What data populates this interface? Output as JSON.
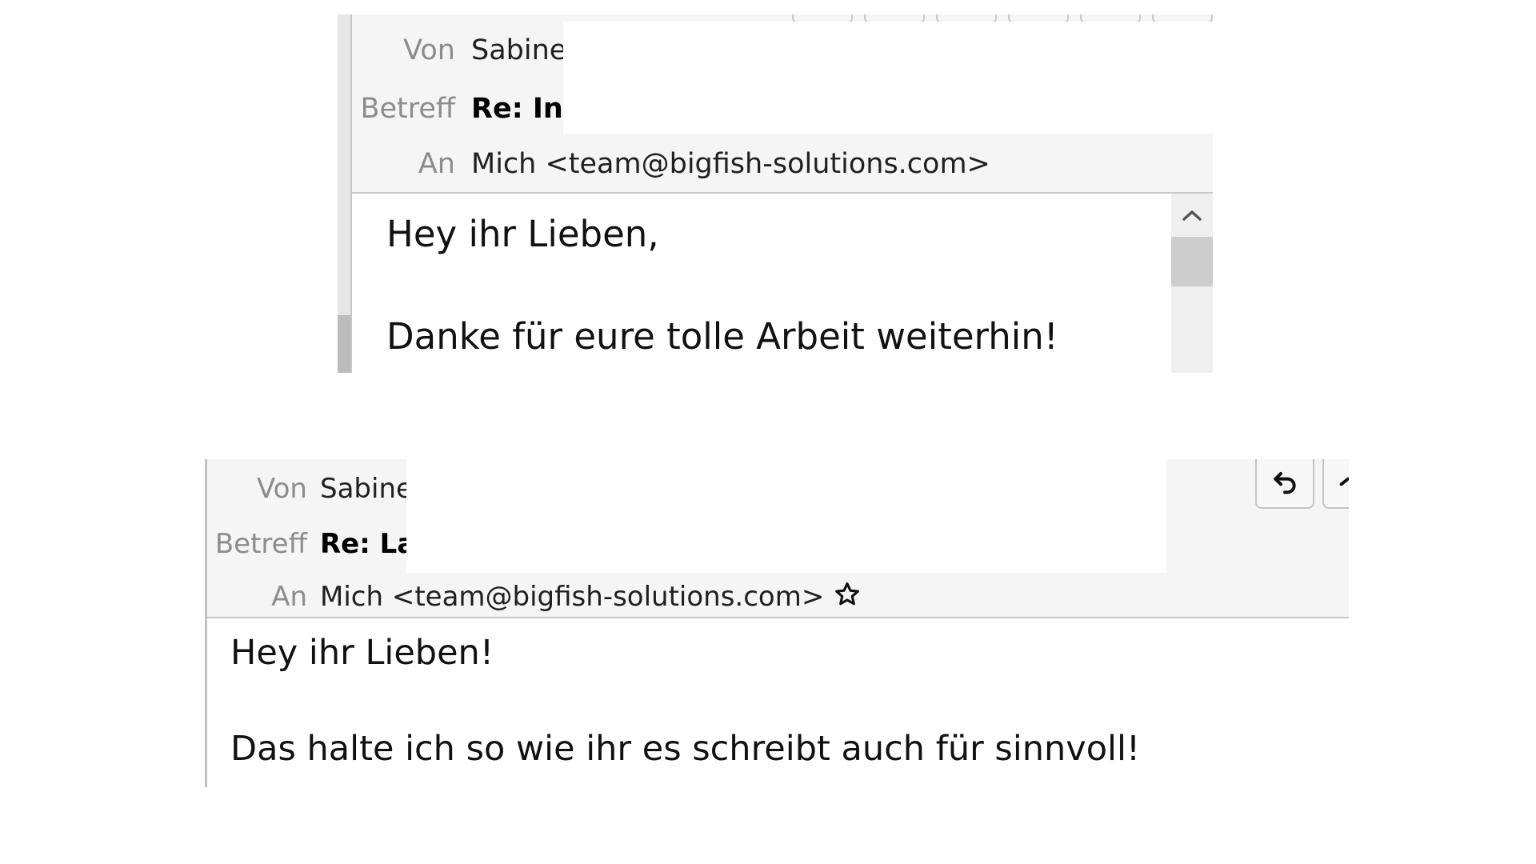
{
  "snippet_top": {
    "from_label": "Von",
    "from_value": "Sabine",
    "subject_label": "Betreff",
    "subject_value": "Re: Inf",
    "to_label": "An",
    "to_value": "Mich <team@bigfish-solutions.com>",
    "body": [
      "Hey ihr Lieben,",
      "Danke für eure tolle Arbeit weiterhin!"
    ]
  },
  "snippet_bottom": {
    "from_label": "Von",
    "from_value": "Sabine",
    "subject_label": "Betreff",
    "subject_value": "Re: La",
    "to_label": "An",
    "to_value": "Mich <team@bigfish-solutions.com>",
    "body": [
      "Hey ihr Lieben!",
      "Das halte ich so wie ihr es schreibt auch für sinnvoll!"
    ]
  },
  "icons": {
    "star": "star-icon",
    "reply": "reply-icon",
    "scroll_up": "chevron-up-icon"
  }
}
